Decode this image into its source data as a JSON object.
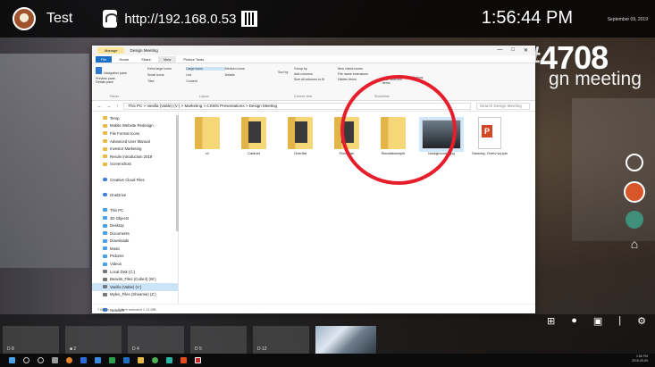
{
  "topbar": {
    "room_name": "Test",
    "url": "http://192.168.0.53",
    "clock": "1:56:44 PM",
    "date": "September 09, 2019"
  },
  "room": {
    "number": "#4708",
    "meeting": "gn meeting"
  },
  "explorer": {
    "tab_manage": "Manage",
    "window_title": "Design Meeting",
    "controls": [
      "—",
      "□",
      "✕"
    ],
    "ribbon_tabs": [
      "File",
      "Home",
      "Share",
      "View",
      "Picture Tools"
    ],
    "ribbon_groups": {
      "panes_items": [
        "Preview pane",
        "Details pane"
      ],
      "navigation_pane": "Navigation pane",
      "layout_items": [
        "Extra large icons",
        "Large icons",
        "Medium icons",
        "Small icons",
        "List",
        "Details",
        "Tiles",
        "Content"
      ],
      "current_view_items": [
        "Group by",
        "Add columns",
        "Size all columns to fit"
      ],
      "sort_label": "Sort by",
      "showhide_items": [
        "Item check boxes",
        "File name extensions",
        "Hidden items"
      ],
      "hide_selected": "Hide selected items",
      "options": "Options",
      "labels": [
        "Panes",
        "Layout",
        "Current view",
        "Show/hide"
      ]
    },
    "address_path": "This PC  >  Vanilla (Vable) (V:)  >  Marketing  >  CSWS Presentations  >  Design Meeting",
    "search_placeholder": "Search Design Meeting",
    "nav_items": [
      {
        "label": "Temp",
        "type": "folder"
      },
      {
        "label": "Mobile Website Redesign",
        "type": "folder"
      },
      {
        "label": "File Format Icons",
        "type": "folder"
      },
      {
        "label": "Advanced User Manual",
        "type": "folder"
      },
      {
        "label": "Investor Marketing",
        "type": "folder"
      },
      {
        "label": "Resolv introduction 2019",
        "type": "folder"
      },
      {
        "label": "Screenshots",
        "type": "folder"
      },
      {
        "label": "",
        "type": "blank"
      },
      {
        "label": "Creative Cloud Files",
        "type": "cloud"
      },
      {
        "label": "",
        "type": "blank"
      },
      {
        "label": "OneDrive",
        "type": "cloud"
      },
      {
        "label": "",
        "type": "blank"
      },
      {
        "label": "This PC",
        "type": "pc"
      },
      {
        "label": "3D Objects",
        "type": "pc"
      },
      {
        "label": "Desktop",
        "type": "pc"
      },
      {
        "label": "Documents",
        "type": "pc"
      },
      {
        "label": "Downloads",
        "type": "pc"
      },
      {
        "label": "Music",
        "type": "pc"
      },
      {
        "label": "Pictures",
        "type": "pc"
      },
      {
        "label": "Videos",
        "type": "pc"
      },
      {
        "label": "Local Disk (C:)",
        "type": "drive"
      },
      {
        "label": "Beavits_Files (Cube4) (W:)",
        "type": "drive"
      },
      {
        "label": "Vanilla (Vable) (V:)",
        "type": "drive",
        "selected": true
      },
      {
        "label": "Myles_Files (Sheamie) (Z:)",
        "type": "drive"
      },
      {
        "label": "",
        "type": "blank"
      },
      {
        "label": "Network",
        "type": "net"
      }
    ],
    "files": [
      {
        "name": "v1",
        "kind": "folder"
      },
      {
        "name": "Cabinet",
        "kind": "folder-dark"
      },
      {
        "name": "Overflat",
        "kind": "folder-dark"
      },
      {
        "name": "Floorplan",
        "kind": "folder-dark"
      },
      {
        "name": "Standalaemple",
        "kind": "folder"
      },
      {
        "name": "backgrounds.jpg",
        "kind": "image",
        "selected": true
      },
      {
        "name": "Saradoy, Overv w.pptx",
        "kind": "ppt"
      }
    ],
    "status_count": "7 items",
    "status_selected": "1 item selected  1.11 MB"
  },
  "tray": {
    "thumbs": [
      "D 8",
      "■ 2",
      "D 4",
      "D 5",
      "D 12"
    ],
    "controls": [
      "⊞",
      "●",
      "▣",
      "|",
      "⚙"
    ]
  },
  "taskbar": {
    "time": "1:56 PM",
    "date": "2019-09-09"
  }
}
